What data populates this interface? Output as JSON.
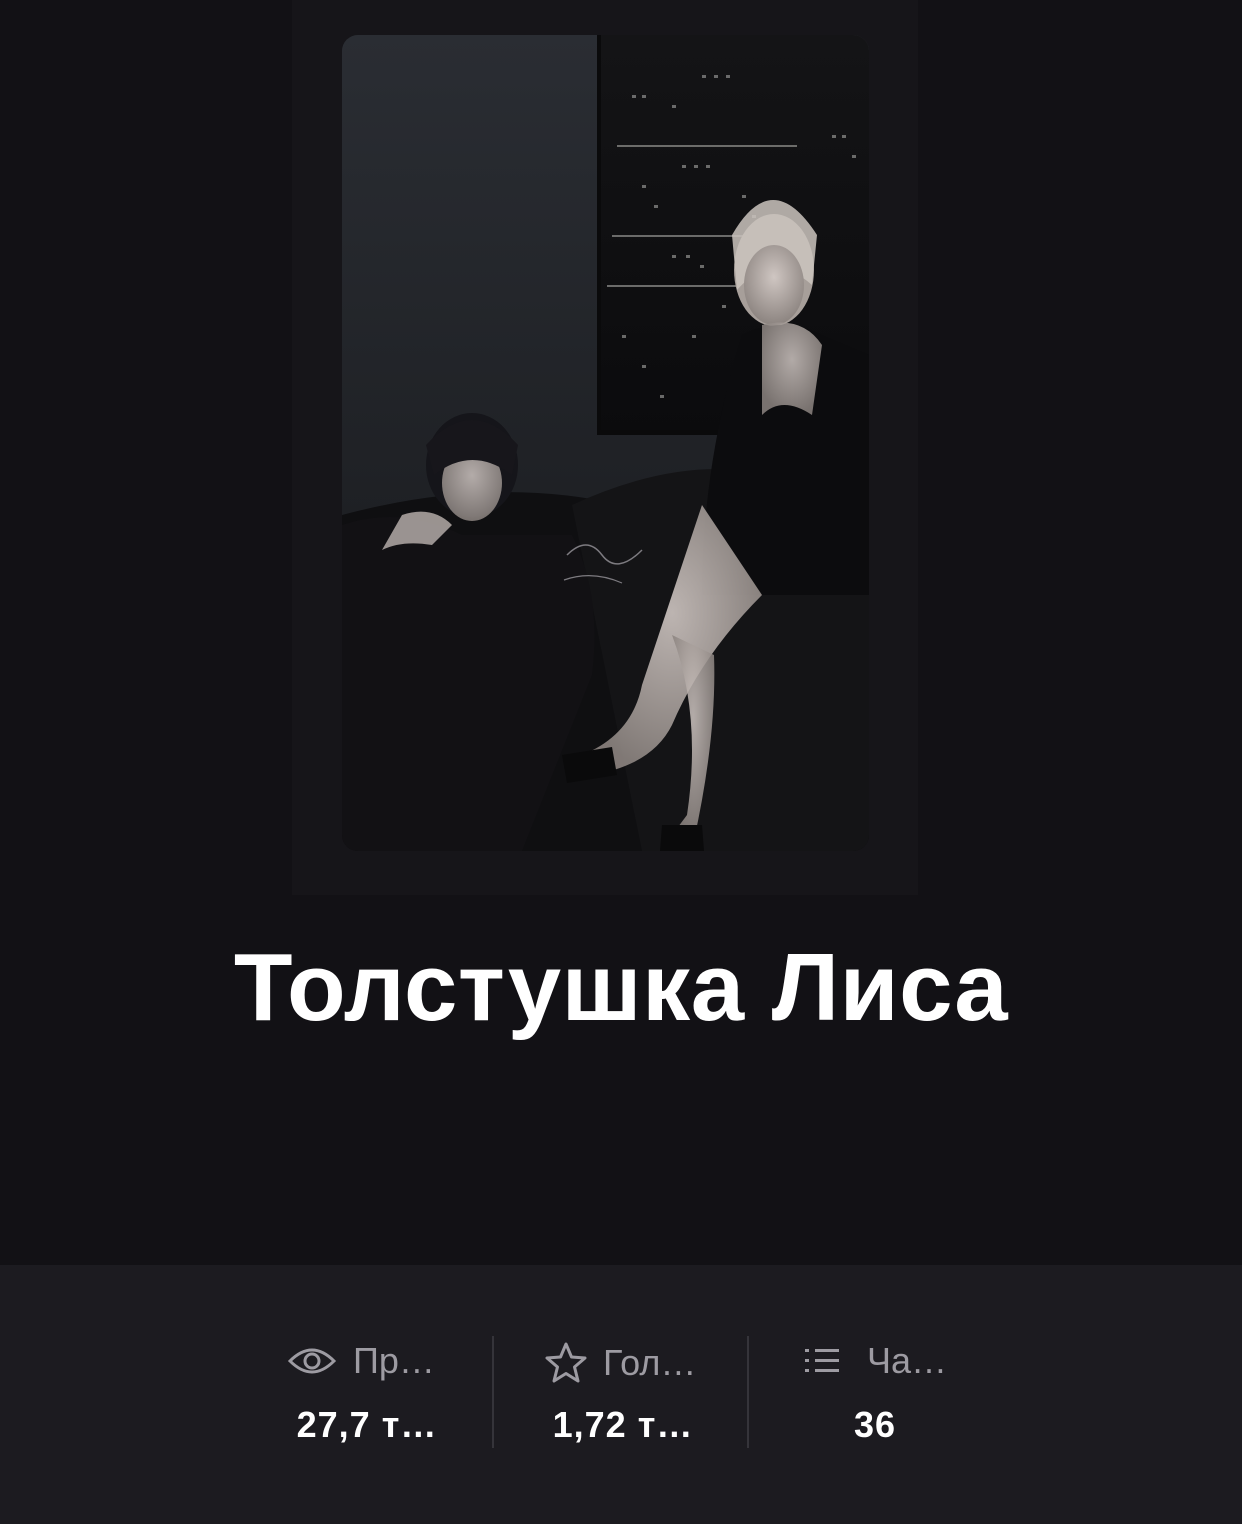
{
  "story": {
    "title": "Толстушка Лиса",
    "cover_icon": "story-cover-image"
  },
  "stats": [
    {
      "icon": "eye-icon",
      "label": "Пр…",
      "value": "27,7 т…"
    },
    {
      "icon": "star-icon",
      "label": "Гол…",
      "value": "1,72 т…"
    },
    {
      "icon": "list-icon",
      "label": "Ча…",
      "value": "36"
    }
  ],
  "colors": {
    "background": "#121115",
    "stats_bar": "#1c1b20",
    "label": "#9d9ba2",
    "value": "#ffffff",
    "title": "#ffffff"
  }
}
